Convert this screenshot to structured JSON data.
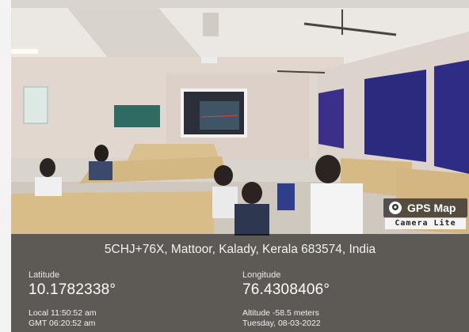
{
  "overlay": {
    "address": "5CHJ+76X, Mattoor, Kalady, Kerala 683574, India",
    "latitude_label": "Latitude",
    "latitude_value": "10.1782338°",
    "longitude_label": "Longitude",
    "longitude_value": "76.4308406°",
    "local_time": "Local 11:50:52 am",
    "gmt_time": "GMT 06:20:52 am",
    "altitude": "Altitude -58.5 meters",
    "date": "Tuesday, 08-03-2022"
  },
  "badge": {
    "title": "GPS Map",
    "subtitle": "Camera Lite",
    "icon": "map-pin-icon"
  }
}
